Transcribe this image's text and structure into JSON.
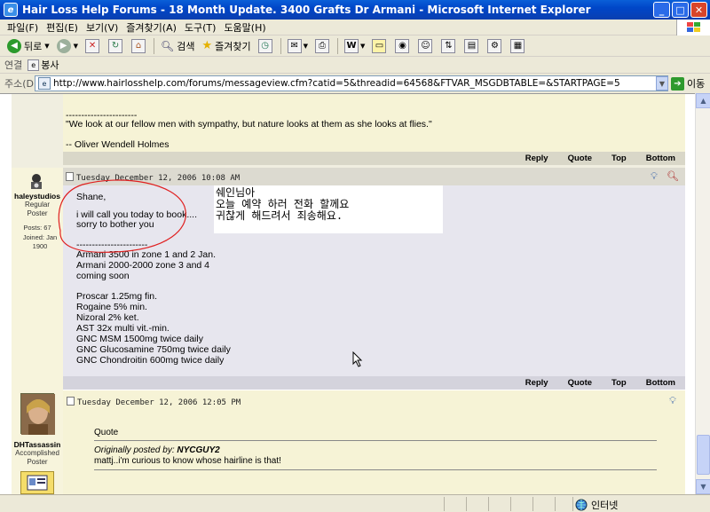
{
  "window": {
    "title": "Hair Loss Help Forums - 18 Month Update. 3400 Grafts Dr Armani - Microsoft Internet Explorer",
    "buttons": [
      "_",
      "□",
      "✕"
    ]
  },
  "menu": [
    "파일(F)",
    "편집(E)",
    "보기(V)",
    "즐겨찾기(A)",
    "도구(T)",
    "도움말(H)"
  ],
  "toolbar": {
    "back": "뒤로",
    "search": "검색",
    "favorites": "즐겨찾기"
  },
  "links": {
    "label": "연결",
    "item": "봉사"
  },
  "address": {
    "label": "주소(D)",
    "url": "http://www.hairlosshelp.com/forums/messageview.cfm?catid=5&threadid=64568&FTVAR_MSGDBTABLE=&STARTPAGE=5",
    "go": "이동"
  },
  "post1": {
    "sig": [
      "-----------------------",
      "\"We look at our fellow men with sympathy, but nature looks at them as she looks at flies.\"",
      "-- Oliver Wendell Holmes"
    ],
    "actions": [
      "Reply",
      "Quote",
      "Top",
      "Bottom"
    ]
  },
  "post2": {
    "author": "haleystudios",
    "rank": "Regular Poster",
    "posts": "Posts: 67",
    "joined": "Joined: Jan 1900",
    "date": "Tuesday December 12, 2006 10:08 AM",
    "body": [
      "Shane,",
      "i will call you today to book....",
      "sorry to bother you",
      "-----------------------",
      "Armani 3500 in zone 1 and 2 Jan.",
      "Armani 2000-2000 zone 3 and 4",
      "coming soon",
      "Proscar 1.25mg fin.",
      "Rogaine 5% min.",
      "Nizoral 2% ket.",
      "AST 32x multi vit.-min.",
      "GNC MSM 1500mg twice daily",
      "GNC Glucosamine 750mg twice daily",
      "GNC Chondroitin 600mg twice daily"
    ],
    "korean_note": [
      "쉐인님아",
      "오늘 예약 하러 전화 할께요",
      "귀찮게 해드려서 죄송해요."
    ],
    "actions": [
      "Reply",
      "Quote",
      "Top",
      "Bottom"
    ]
  },
  "post3": {
    "author": "DHTassassin",
    "rank": "Accomplished Poster",
    "date": "Tuesday December 12, 2006 12:05 PM",
    "quote_label": "Quote",
    "quote_by_prefix": "Originally posted by:",
    "quote_by": "NYCGUY2",
    "quote_text": "mattj..i'm curious to know whose hairline is that!"
  },
  "status": {
    "zone": "인터넷"
  }
}
